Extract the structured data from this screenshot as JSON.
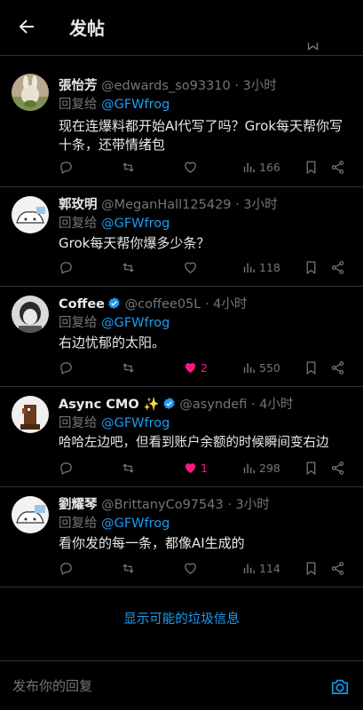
{
  "header": {
    "title": "发帖"
  },
  "replies": [
    {
      "name": "張怡芳",
      "handle": "@edwards_so93310",
      "time": "· 3小时",
      "reply_prefix": "回复给 ",
      "reply_to": "@GFWfrog",
      "content": "现在连爆料都开始AI代写了吗？Grok每天帮你写十条，还带情绪包",
      "views": "166",
      "likes": ""
    },
    {
      "name": "郭玫明",
      "handle": "@MeganHall125429",
      "time": "· 3小时",
      "reply_prefix": "回复给 ",
      "reply_to": "@GFWfrog",
      "content": "Grok每天帮你爆多少条？",
      "views": "118",
      "likes": ""
    },
    {
      "name": "Coffee",
      "handle": "@coffee05L",
      "time": "· 4小时",
      "reply_prefix": "回复给 ",
      "reply_to": "@GFWfrog",
      "content": "右边忧郁的太阳。",
      "views": "550",
      "likes": "2",
      "verified": true
    },
    {
      "name": "Async CMO ✨",
      "handle": "@asyndefi",
      "time": "· 4小时",
      "reply_prefix": "回复给 ",
      "reply_to": "@GFWfrog",
      "content": "哈哈左边吧，但看到账户余额的时候瞬间变右边",
      "views": "298",
      "likes": "1",
      "verified": true
    },
    {
      "name": "劉耀琴",
      "handle": "@BrittanyCo97543",
      "time": "· 3小时",
      "reply_prefix": "回复给 ",
      "reply_to": "@GFWfrog",
      "content": "看你发的每一条，都像AI生成的",
      "views": "114",
      "likes": ""
    }
  ],
  "show_more": "显示可能的垃圾信息",
  "compose": {
    "placeholder": "发布你的回复"
  },
  "colors": {
    "accent": "#1d9bf0",
    "like": "#f91880",
    "muted": "#71767b"
  }
}
